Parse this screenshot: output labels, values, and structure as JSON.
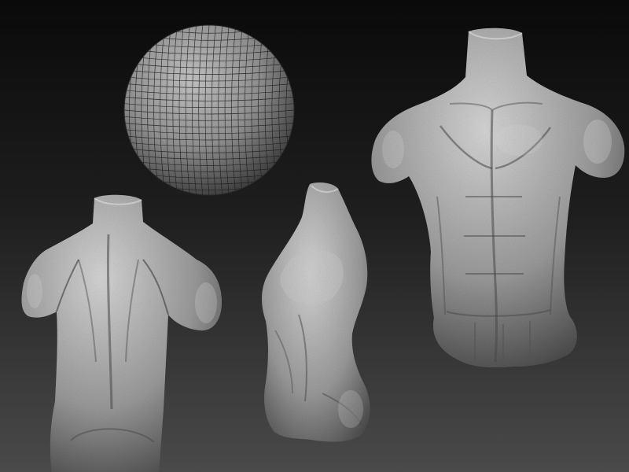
{
  "scene": {
    "background_top": "#0a0a0a",
    "background_mid": "#1e1e1e",
    "background_bottom": "#4a4a4a",
    "clay_light": "#d6d6d6",
    "clay_mid": "#9a9a9a",
    "clay_dark": "#3c3c3c",
    "wire_color": "#1c1c1c",
    "objects": [
      "wireframe-sphere",
      "torso-back-view",
      "torso-side-view",
      "torso-front-view"
    ]
  }
}
